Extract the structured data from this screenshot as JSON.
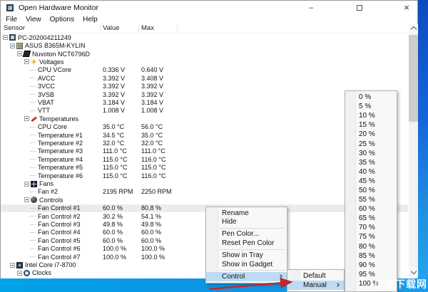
{
  "window": {
    "title": "Open Hardware Monitor"
  },
  "titlebar": {
    "minimize_label": "–",
    "close_label": "×"
  },
  "menu_bar": {
    "items": [
      {
        "label": "File"
      },
      {
        "label": "View"
      },
      {
        "label": "Options"
      },
      {
        "label": "Help"
      }
    ]
  },
  "columns": [
    {
      "label": "Sensor"
    },
    {
      "label": "Value"
    },
    {
      "label": "Max"
    }
  ],
  "tree": {
    "rows": [
      {
        "level": 0,
        "icon": "computer",
        "label": "PC-202004211249",
        "value": "",
        "max": ""
      },
      {
        "level": 1,
        "icon": "mainboard",
        "label": "ASUS B365M-KYLIN",
        "value": "",
        "max": ""
      },
      {
        "level": 2,
        "icon": "chip",
        "label": "Nuvoton NCT6796D",
        "value": "",
        "max": ""
      },
      {
        "level": 3,
        "icon": "voltage",
        "label": "Voltages",
        "value": "",
        "max": ""
      },
      {
        "level": 4,
        "icon": "",
        "label": "CPU VCore",
        "value": "0.336 V",
        "max": "0.640 V"
      },
      {
        "level": 4,
        "icon": "",
        "label": "AVCC",
        "value": "3.392 V",
        "max": "3.408 V"
      },
      {
        "level": 4,
        "icon": "",
        "label": "3VCC",
        "value": "3.392 V",
        "max": "3.392 V"
      },
      {
        "level": 4,
        "icon": "",
        "label": "3VSB",
        "value": "3.392 V",
        "max": "3.392 V"
      },
      {
        "level": 4,
        "icon": "",
        "label": "VBAT",
        "value": "3.184 V",
        "max": "3.184 V"
      },
      {
        "level": 4,
        "icon": "",
        "label": "VTT",
        "value": "1.008 V",
        "max": "1.008 V"
      },
      {
        "level": 3,
        "icon": "temperature",
        "label": "Temperatures",
        "value": "",
        "max": ""
      },
      {
        "level": 4,
        "icon": "",
        "label": "CPU Core",
        "value": "35.0 °C",
        "max": "56.0 °C"
      },
      {
        "level": 4,
        "icon": "",
        "label": "Temperature #1",
        "value": "34.5 °C",
        "max": "35.0 °C"
      },
      {
        "level": 4,
        "icon": "",
        "label": "Temperature #2",
        "value": "32.0 °C",
        "max": "32.0 °C"
      },
      {
        "level": 4,
        "icon": "",
        "label": "Temperature #3",
        "value": "111.0 °C",
        "max": "111.0 °C"
      },
      {
        "level": 4,
        "icon": "",
        "label": "Temperature #4",
        "value": "115.0 °C",
        "max": "116.0 °C"
      },
      {
        "level": 4,
        "icon": "",
        "label": "Temperature #5",
        "value": "115.0 °C",
        "max": "115.0 °C"
      },
      {
        "level": 4,
        "icon": "",
        "label": "Temperature #6",
        "value": "115.0 °C",
        "max": "116.0 °C"
      },
      {
        "level": 3,
        "icon": "fan",
        "label": "Fans",
        "value": "",
        "max": ""
      },
      {
        "level": 4,
        "icon": "",
        "label": "Fan #2",
        "value": "2195 RPM",
        "max": "2250 RPM"
      },
      {
        "level": 3,
        "icon": "control",
        "label": "Controls",
        "value": "",
        "max": ""
      },
      {
        "level": 4,
        "icon": "",
        "label": "Fan Control #1",
        "value": "60.0 %",
        "max": "80.8 %",
        "selected": true
      },
      {
        "level": 4,
        "icon": "",
        "label": "Fan Control #2",
        "value": "30.2 %",
        "max": "54.1 %"
      },
      {
        "level": 4,
        "icon": "",
        "label": "Fan Control #3",
        "value": "49.8 %",
        "max": "49.8 %"
      },
      {
        "level": 4,
        "icon": "",
        "label": "Fan Control #4",
        "value": "60.0 %",
        "max": "60.0 %"
      },
      {
        "level": 4,
        "icon": "",
        "label": "Fan Control #5",
        "value": "60.0 %",
        "max": "60.0 %"
      },
      {
        "level": 4,
        "icon": "",
        "label": "Fan Control #6",
        "value": "100.0 %",
        "max": "100.0 %"
      },
      {
        "level": 4,
        "icon": "",
        "label": "Fan Control #7",
        "value": "100.0 %",
        "max": "100.0 %"
      },
      {
        "level": 1,
        "icon": "cpu",
        "label": "Intel Core i7-8700",
        "value": "",
        "max": ""
      },
      {
        "level": 2,
        "icon": "clock",
        "label": "Clocks",
        "value": "",
        "max": ""
      }
    ]
  },
  "context_menu": {
    "items": [
      {
        "type": "item",
        "label": "Rename"
      },
      {
        "type": "item",
        "label": "Hide"
      },
      {
        "type": "sep"
      },
      {
        "type": "item",
        "label": "Pen Color..."
      },
      {
        "type": "item",
        "label": "Reset Pen Color"
      },
      {
        "type": "sep"
      },
      {
        "type": "item",
        "label": "Show in Tray"
      },
      {
        "type": "item",
        "label": "Show in Gadget"
      },
      {
        "type": "sep"
      },
      {
        "type": "item",
        "label": "Control",
        "has_submenu": true,
        "highlighted": true
      }
    ]
  },
  "control_submenu": {
    "items": [
      {
        "type": "item",
        "label": "Default"
      },
      {
        "type": "item",
        "label": "Manual",
        "has_submenu": true,
        "highlighted": true
      }
    ]
  },
  "percent_menu": {
    "items": [
      "0 %",
      "5 %",
      "10 %",
      "15 %",
      "20 %",
      "25 %",
      "30 %",
      "35 %",
      "40 %",
      "45 %",
      "50 %",
      "55 %",
      "60 %",
      "65 %",
      "70 %",
      "75 %",
      "80 %",
      "85 %",
      "90 %",
      "95 %",
      "100 %"
    ]
  },
  "annotation": {
    "arrow_color": "#c1272d"
  },
  "watermark": {
    "text": "爪神下载网"
  },
  "colors": {
    "menu_highlight": "#bddcf4",
    "banner_blue": "#00a2e8",
    "desktop_blue": "#1565d8",
    "selected_row": "#ececec"
  }
}
